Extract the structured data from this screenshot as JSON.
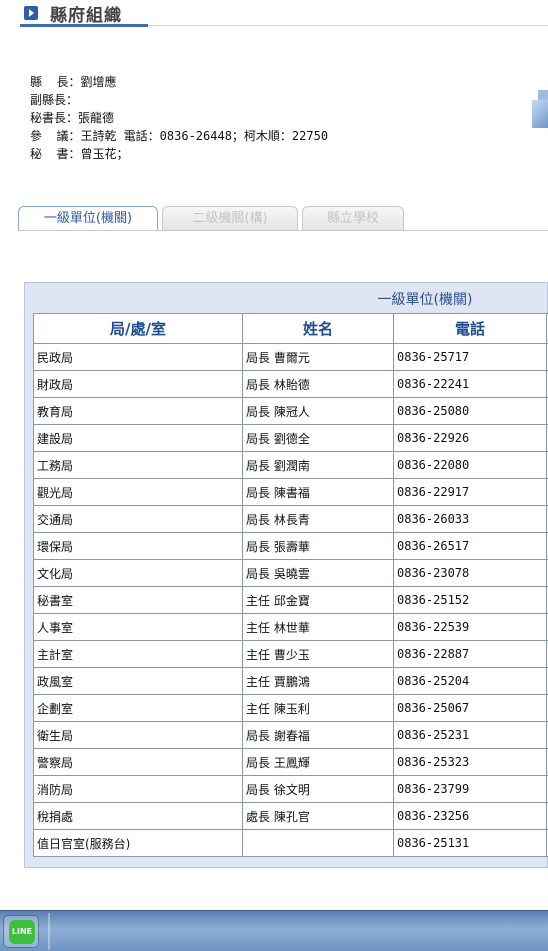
{
  "header": {
    "title": "縣府組織"
  },
  "officials": [
    "縣  長：劉增應",
    "副縣長：",
    "秘書長：張龍德",
    "參  議：王詩乾 電話：0836-26448；柯木順：22750",
    "秘  書：曾玉花；"
  ],
  "tabs": [
    {
      "label": "一級單位(機關)",
      "active": true
    },
    {
      "label": "二級機關(構)",
      "active": false
    },
    {
      "label": "縣立學校",
      "active": false
    }
  ],
  "table": {
    "title": "一級單位(機關)",
    "headers": [
      "局/處/室",
      "姓名",
      "電話"
    ],
    "rows": [
      [
        "民政局",
        "局長 曹爾元",
        "0836-25717"
      ],
      [
        "財政局",
        "局長 林貽德",
        "0836-22241"
      ],
      [
        "教育局",
        "局長 陳冠人",
        "0836-25080"
      ],
      [
        "建設局",
        "局長 劉德全",
        "0836-22926"
      ],
      [
        "工務局",
        "局長 劉潤南",
        "0836-22080"
      ],
      [
        "觀光局",
        "局長 陳書福",
        "0836-22917"
      ],
      [
        "交通局",
        "局長 林長青",
        "0836-26033"
      ],
      [
        "環保局",
        "局長 張壽華",
        "0836-26517"
      ],
      [
        "文化局",
        "局長 吳曉雲",
        "0836-23078"
      ],
      [
        "秘書室",
        "主任 邱金寶",
        "0836-25152"
      ],
      [
        "人事室",
        "主任 林世華",
        "0836-22539"
      ],
      [
        "主計室",
        "主任 曹少玉",
        "0836-22887"
      ],
      [
        "政風室",
        "主任 賈鵬鴻",
        "0836-25204"
      ],
      [
        "企劃室",
        "主任 陳玉利",
        "0836-25067"
      ],
      [
        "衛生局",
        "局長 謝春福",
        "0836-25231"
      ],
      [
        "警察局",
        "局長 王鳳輝",
        "0836-25323"
      ],
      [
        "消防局",
        "局長 徐文明",
        "0836-23799"
      ],
      [
        "稅捐處",
        "處長 陳孔官",
        "0836-23256"
      ],
      [
        "值日官室(服務台)",
        "",
        "0836-25131"
      ]
    ]
  },
  "taskbar": {
    "line_label": "LINE"
  },
  "colors": {
    "accent": "#3b6eb0",
    "header_text": "#1e4e8c",
    "panel_bg": "#dde6f2",
    "line_green": "#3cbf3c"
  }
}
